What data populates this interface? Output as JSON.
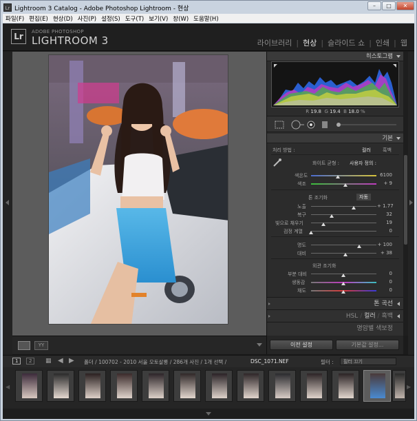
{
  "window": {
    "title": "Lightroom 3 Catalog - Adobe Photoshop Lightroom - 현상",
    "icon_label": "Lr",
    "controls": [
      "–",
      "□",
      "✕"
    ]
  },
  "menu": [
    "파일(F)",
    "편집(E)",
    "현상(D)",
    "사진(P)",
    "설정(S)",
    "도구(T)",
    "보기(V)",
    "창(W)",
    "도움말(H)"
  ],
  "header": {
    "logo": "Lr",
    "brand_small": "ADOBE PHOTOSHOP",
    "brand_large": "LIGHTROOM 3",
    "modules": [
      "라이브러리",
      "현상",
      "슬라이드 쇼",
      "인쇄",
      "웹"
    ],
    "active_module": "현상"
  },
  "histogram": {
    "title": "히스토그램",
    "r_label": "R",
    "r_value": "19.8",
    "g_label": "G",
    "g_value": "19.4",
    "b_label": "B",
    "b_value": "18.0",
    "pct": "%"
  },
  "basic": {
    "title": "기본",
    "treatment_label": "처리 방법 :",
    "treatment_color": "컬러",
    "treatment_bw": "흑백",
    "wb_label": "화이트 균형 :",
    "wb_value": "사용자 정의 :",
    "temp_label": "색온도",
    "temp_value": "6100",
    "tint_label": "색조",
    "tint_value": "+ 9",
    "tone_label": "톤 조기화",
    "auto_label": "자동",
    "exposure_label": "노출",
    "exposure_value": "+ 1.77",
    "recovery_label": "복구",
    "recovery_value": "32",
    "fill_label": "빛으로 채우기",
    "fill_value": "19",
    "blacks_label": "검정 계열",
    "blacks_value": "0",
    "brightness_label": "명도",
    "brightness_value": "+ 100",
    "contrast_label": "대비",
    "contrast_value": "+ 38",
    "presence_label": "외관 조기화",
    "clarity_label": "부분 대비",
    "clarity_value": "0",
    "vibrance_label": "생동감",
    "vibrance_value": "0",
    "saturation_label": "채도",
    "saturation_value": "0"
  },
  "collapsed_panels": {
    "tone_curve": "톤 곡선",
    "hsl": "HSL",
    "hsl_color": "컬러",
    "hsl_bw": "흑백",
    "split": "명암별 색보정"
  },
  "right_buttons": {
    "previous": "이전 설정",
    "reset": "기본값 설정..."
  },
  "filmbar": {
    "screen1": "1",
    "screen2": "2",
    "path": "폴더 / 100702 - 2010 서울 오토살롱 / 286개 사진 / 1개 선택 /",
    "filename": "DSC_1071.NEF",
    "filter_label": "필터 :",
    "filter_value": "필터 끄기"
  },
  "colors": {
    "accent": "#d9d9d9",
    "panel_bg": "#2c2c2c",
    "center_bg": "#5c5c5c"
  }
}
